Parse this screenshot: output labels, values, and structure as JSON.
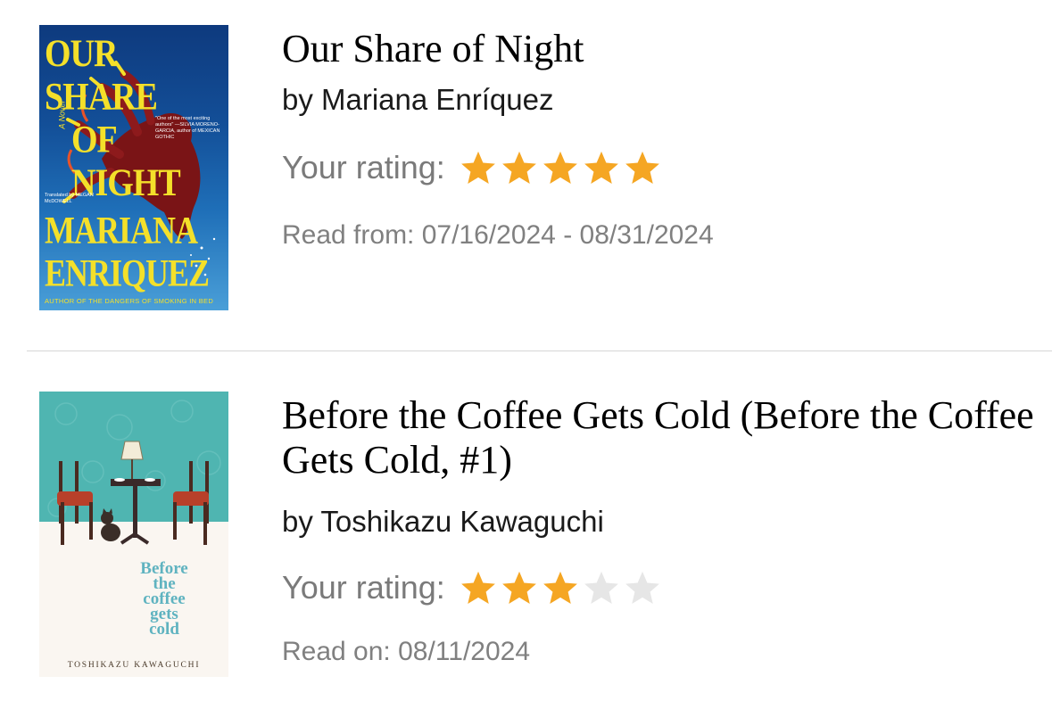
{
  "books": [
    {
      "title": "Our Share of Night",
      "author": "by Mariana Enríquez",
      "rating_label": "Your rating:",
      "rating": 5,
      "rating_max": 5,
      "read_date": "Read from: 07/16/2024 - 08/31/2024",
      "cover": {
        "title_line1": "OUR SHARE",
        "title_line2": "OF NIGHT",
        "author_line1": "MARIANA",
        "author_line2": "ENRIQUEZ",
        "tagline": "AUTHOR OF THE DANGERS OF SMOKING IN BED",
        "novel_label": "A Novel",
        "intro": "Translated by MEGAN McDOWELL",
        "quote": "\"One of the most exciting authors\" —SILVIA MORENO-GARCIA, author of MEXICAN GOTHIC",
        "bg_color": "#134f98",
        "text_color": "#f4e02a"
      }
    },
    {
      "title": "Before the Coffee Gets Cold (Before the Coffee Gets Cold, #1)",
      "author": "by Toshikazu Kawaguchi",
      "rating_label": "Your rating:",
      "rating": 3,
      "rating_max": 5,
      "read_date": "Read on: 08/11/2024",
      "cover": {
        "title_line1": "Before",
        "title_line2": "the",
        "title_line3": "coffee",
        "title_line4": "gets",
        "title_line5": "cold",
        "author": "TOSHIKAZU KAWAGUCHI",
        "bg_color": "#4fb5b1",
        "text_color": "#5fb3c0"
      }
    }
  ],
  "colors": {
    "star_filled": "#f5a623",
    "star_empty": "#e6e6e6",
    "meta_text": "#808080",
    "divider": "#d6d6d6"
  }
}
